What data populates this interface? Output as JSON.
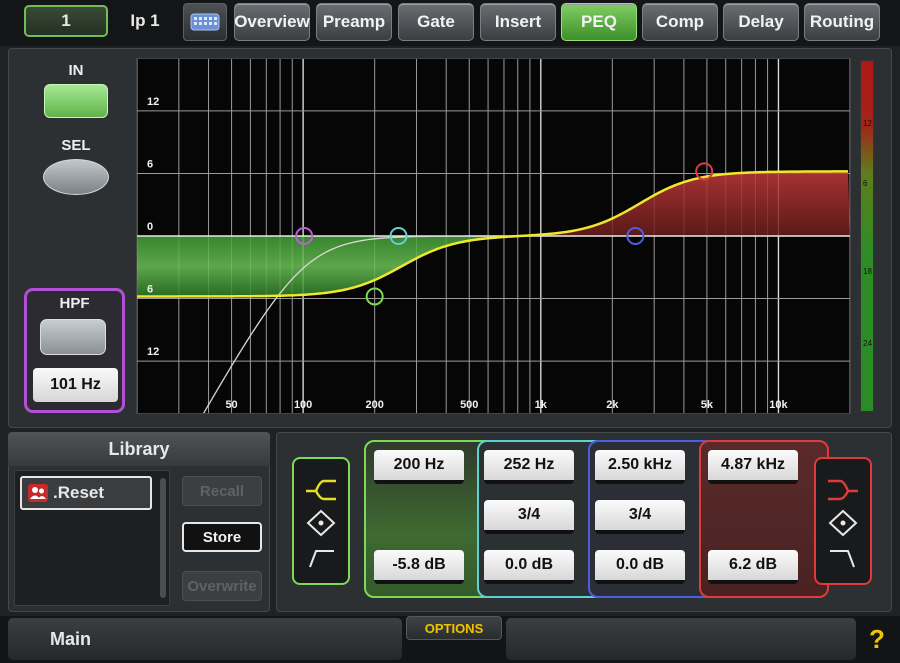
{
  "header": {
    "channel_number": "1",
    "channel_name": "Ip 1",
    "keyboard_icon": "keyboard-icon",
    "tabs": [
      {
        "label": "Overview",
        "active": false
      },
      {
        "label": "Preamp",
        "active": false
      },
      {
        "label": "Gate",
        "active": false
      },
      {
        "label": "Insert",
        "active": false
      },
      {
        "label": "PEQ",
        "active": true
      },
      {
        "label": "Comp",
        "active": false
      },
      {
        "label": "Delay",
        "active": false
      },
      {
        "label": "Routing",
        "active": false
      }
    ]
  },
  "controls": {
    "in_label": "IN",
    "sel_label": "SEL",
    "hpf_label": "HPF",
    "hpf_value": "101 Hz"
  },
  "graph": {
    "x_scale": "log",
    "x_range_hz": [
      20,
      20000
    ],
    "y_range_db": [
      -18,
      18
    ],
    "x_tick_labels": [
      {
        "hz": 50,
        "label": "50"
      },
      {
        "hz": 100,
        "label": "100"
      },
      {
        "hz": 200,
        "label": "200"
      },
      {
        "hz": 500,
        "label": "500"
      },
      {
        "hz": 1000,
        "label": "1k"
      },
      {
        "hz": 2000,
        "label": "2k"
      },
      {
        "hz": 5000,
        "label": "5k"
      },
      {
        "hz": 10000,
        "label": "10k"
      }
    ],
    "y_tick_labels": [
      {
        "db": 12,
        "label": "12"
      },
      {
        "db": 6,
        "label": "6"
      },
      {
        "db": 0,
        "label": "0"
      },
      {
        "db": -6,
        "label": "6"
      },
      {
        "db": -12,
        "label": "12"
      }
    ],
    "nodes": [
      {
        "name": "hpf-node",
        "hz": 101,
        "db": 0,
        "color": "#c45adf"
      },
      {
        "name": "band1-node",
        "hz": 200,
        "db": -5.8,
        "color": "#7ed957"
      },
      {
        "name": "band2-node",
        "hz": 252,
        "db": 0,
        "color": "#5fd0d6"
      },
      {
        "name": "band3-node",
        "hz": 2500,
        "db": 0,
        "color": "#4b5fe0"
      },
      {
        "name": "band4-node",
        "hz": 4870,
        "db": 6.2,
        "color": "#e03a3a"
      }
    ]
  },
  "meter": {
    "labels": [
      "12",
      "6",
      "18",
      "24"
    ]
  },
  "library": {
    "title": "Library",
    "items": [
      {
        "label": ".Reset",
        "icon": "users-icon"
      }
    ],
    "recall_label": "Recall",
    "store_label": "Store",
    "overwrite_label": "Overwrite"
  },
  "bands": [
    {
      "freq": "200 Hz",
      "width": "",
      "gain": "-5.8 dB",
      "color": "#7ed957"
    },
    {
      "freq": "252 Hz",
      "width": "3/4",
      "gain": "0.0 dB",
      "color": "#5fd0d6"
    },
    {
      "freq": "2.50 kHz",
      "width": "3/4",
      "gain": "0.0 dB",
      "color": "#4b5fe0"
    },
    {
      "freq": "4.87 kHz",
      "width": "",
      "gain": "6.2 dB",
      "color": "#e03a3a"
    }
  ],
  "shape_selectors": {
    "low": {
      "color": "#7ed957",
      "options": [
        "shelf-low-icon",
        "bell-icon",
        "hpf-slope-icon"
      ],
      "selected": "shelf-low-icon"
    },
    "high": {
      "color": "#e03a3a",
      "options": [
        "shelf-high-icon",
        "bell-icon",
        "lpf-slope-icon"
      ],
      "selected": "shelf-high-icon"
    }
  },
  "footer": {
    "main_label": "Main",
    "options_label": "OPTIONS",
    "help_label": "?"
  }
}
